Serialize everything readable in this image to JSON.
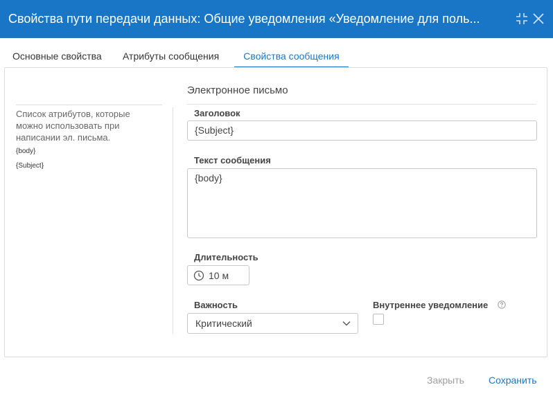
{
  "dialog": {
    "title": "Свойства пути передачи данных: Общие уведомления «Уведомление для поль...",
    "header_color": "#1976c7",
    "icons": [
      "collapse-icon",
      "close-icon"
    ]
  },
  "tabs": [
    {
      "label": "Основные свойства",
      "active": false
    },
    {
      "label": "Атрибуты сообщения",
      "active": false
    },
    {
      "label": "Свойства сообщения",
      "active": true
    }
  ],
  "sidebar": {
    "description": "Список атрибутов, которые можно использовать при написании эл. письма.",
    "attributes": [
      "{body}",
      "{Subject}"
    ]
  },
  "form": {
    "section_title": "Электронное письмо",
    "subject": {
      "label": "Заголовок",
      "value": "{Subject}"
    },
    "body": {
      "label": "Текст сообщения",
      "value": "{body}"
    },
    "duration": {
      "label": "Длительность",
      "value": "10 м",
      "icon": "clock-icon"
    },
    "importance": {
      "label": "Важность",
      "value": "Критический"
    },
    "internal_notification": {
      "label": "Внутреннее уведомление",
      "checked": false,
      "icon": "help-icon"
    }
  },
  "footer": {
    "close_label": "Закрыть",
    "save_label": "Сохранить"
  }
}
